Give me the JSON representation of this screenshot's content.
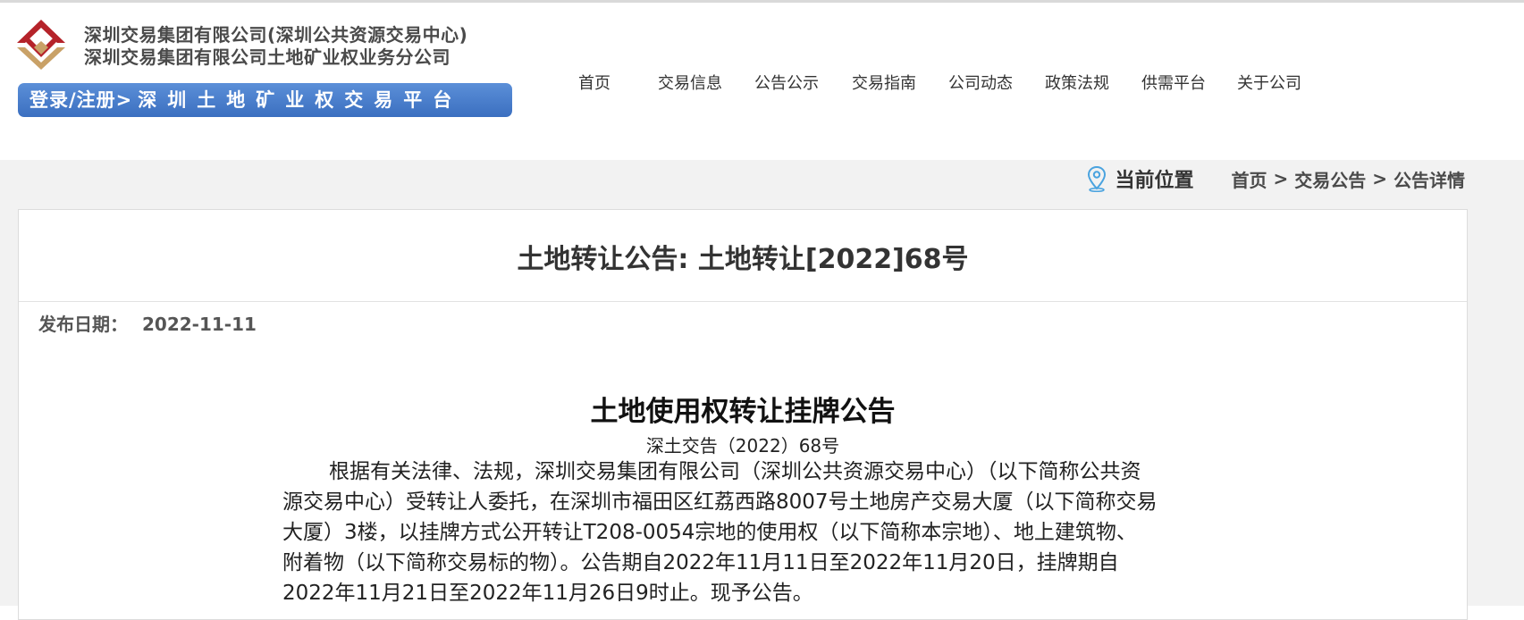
{
  "header": {
    "org_name_line1": "深圳交易集团有限公司(深圳公共资源交易中心)",
    "org_name_line2": "深圳交易集团有限公司土地矿业权业务分公司",
    "login_link": "登录/注册>",
    "platform_name": "深圳土地矿业权交易平台"
  },
  "nav": {
    "items": [
      "首页",
      "交易信息",
      "公告公示",
      "交易指南",
      "公司动态",
      "政策法规",
      "供需平台",
      "关于公司"
    ]
  },
  "breadcrumb": {
    "label": "当前位置",
    "items": [
      "首页",
      "交易公告",
      "公告详情"
    ],
    "separator": ">"
  },
  "article": {
    "title": "土地转让公告: 土地转让[2022]68号",
    "publish_label": "发布日期：",
    "publish_date": "2022-11-11",
    "doc_title": "土地使用权转让挂牌公告",
    "doc_number": "深土交告（2022）68号",
    "body_lines": [
      "根据有关法律、法规，深圳交易集团有限公司（深圳公共资源交易中心）（以下简称公共资",
      "源交易中心）受转让人委托，在深圳市福田区红荔西路8007号土地房产交易大厦（以下简称交易",
      "大厦）3楼，以挂牌方式公开转让T208-0054宗地的使用权（以下简称本宗地）、地上建筑物、",
      "附着物（以下简称交易标的物）。公告期自2022年11月11日至2022年11月20日，挂牌期自",
      "2022年11月21日至2022年11月26日9时止。现予公告。"
    ]
  },
  "colors": {
    "brand_red": "#b5232a",
    "brand_gold": "#c9a167",
    "banner_blue": "#4a7fcf",
    "pin_blue": "#4aa3df"
  }
}
